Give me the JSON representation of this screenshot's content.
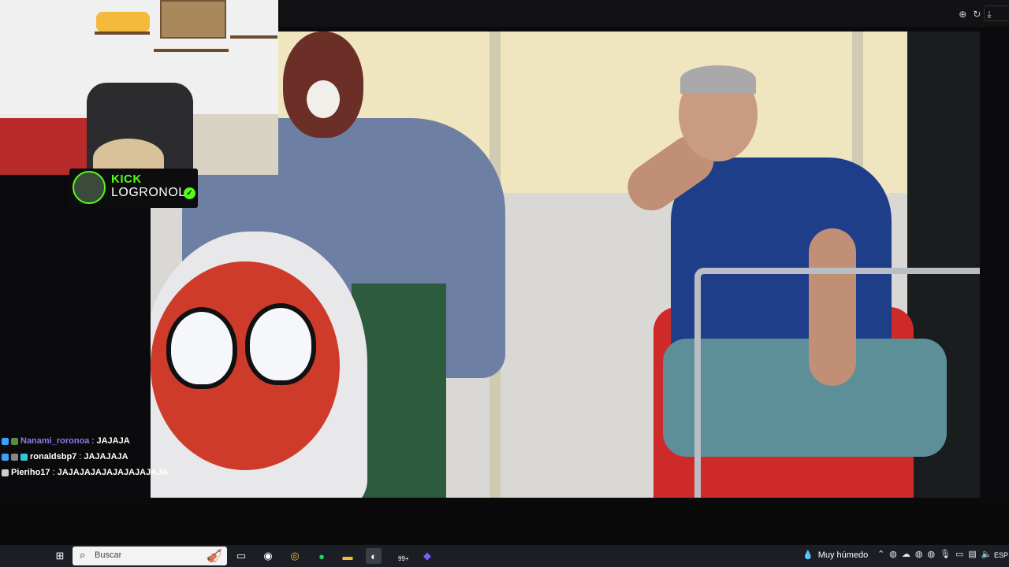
{
  "topbar": {
    "message": "",
    "button_label": ""
  },
  "viewer_tools": {
    "zoom_icon": "zoom-in-icon",
    "redo_icon": "redo-icon",
    "download_icon": "download-icon"
  },
  "kick": {
    "brand": "KICK",
    "channel": "LOGRONOL"
  },
  "chat": {
    "messages": [
      {
        "user": "Nanami_roronoa",
        "text": "JAJAJA",
        "user_color": "#8c7ae6"
      },
      {
        "user": "ronaldsbp7",
        "text": "JAJAJAJA",
        "user_color": "#ffffff"
      },
      {
        "user": "Pieriho17",
        "text": "JAJAJAJAJAJAJAJAJAJA",
        "user_color": "#ffffff"
      }
    ],
    "separator": ":"
  },
  "taskbar": {
    "search_placeholder": "Buscar",
    "whatsapp_badge": "99+",
    "weather_text": "Muy húmedo",
    "lang": "ESP"
  },
  "colors": {
    "kick_green": "#53fc18",
    "taskbar_bg": "#1b1e24"
  }
}
